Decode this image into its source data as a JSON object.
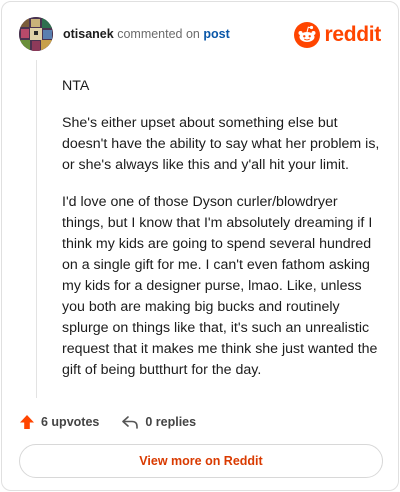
{
  "header": {
    "username": "otisanek",
    "action_text": "commented on",
    "post_link": "post",
    "brand": "reddit",
    "brand_color": "#ff4500"
  },
  "comment": {
    "paragraphs": [
      "NTA",
      "She's either upset about something else but doesn't have the ability to say what her problem is, or she's always like this and y'all hit your limit.",
      "I'd love one of those Dyson curler/blowdryer things, but I know that I'm absolutely dreaming if I think my kids are going to spend several hundred on a single gift for me. I can't even fathom asking my kids for a designer purse, lmao. Like, unless you both are making big bucks and routinely splurge on things like that, it's such an unrealistic request that it makes me think she just wanted the gift of being butthurt for the day."
    ]
  },
  "footer": {
    "upvotes": "6 upvotes",
    "replies": "0 replies",
    "view_more": "View more on Reddit",
    "upvote_icon": "upvote-arrow-icon",
    "reply_icon": "reply-arrow-icon"
  }
}
